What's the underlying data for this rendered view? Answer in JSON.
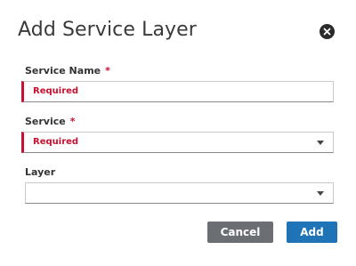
{
  "dialog": {
    "title": "Add Service Layer",
    "close_icon": "close-circle-icon"
  },
  "fields": {
    "service_name": {
      "label": "Service Name",
      "required_marker": "*",
      "value": "Required",
      "error_color": "#c8102e"
    },
    "service": {
      "label": "Service",
      "required_marker": "*",
      "value": "Required",
      "dropdown_icon": "chevron-down-icon"
    },
    "layer": {
      "label": "Layer",
      "value": "",
      "dropdown_icon": "chevron-down-icon"
    }
  },
  "buttons": {
    "cancel_label": "Cancel",
    "add_label": "Add",
    "cancel_color": "#6b6f74",
    "add_color": "#1f73b7"
  }
}
